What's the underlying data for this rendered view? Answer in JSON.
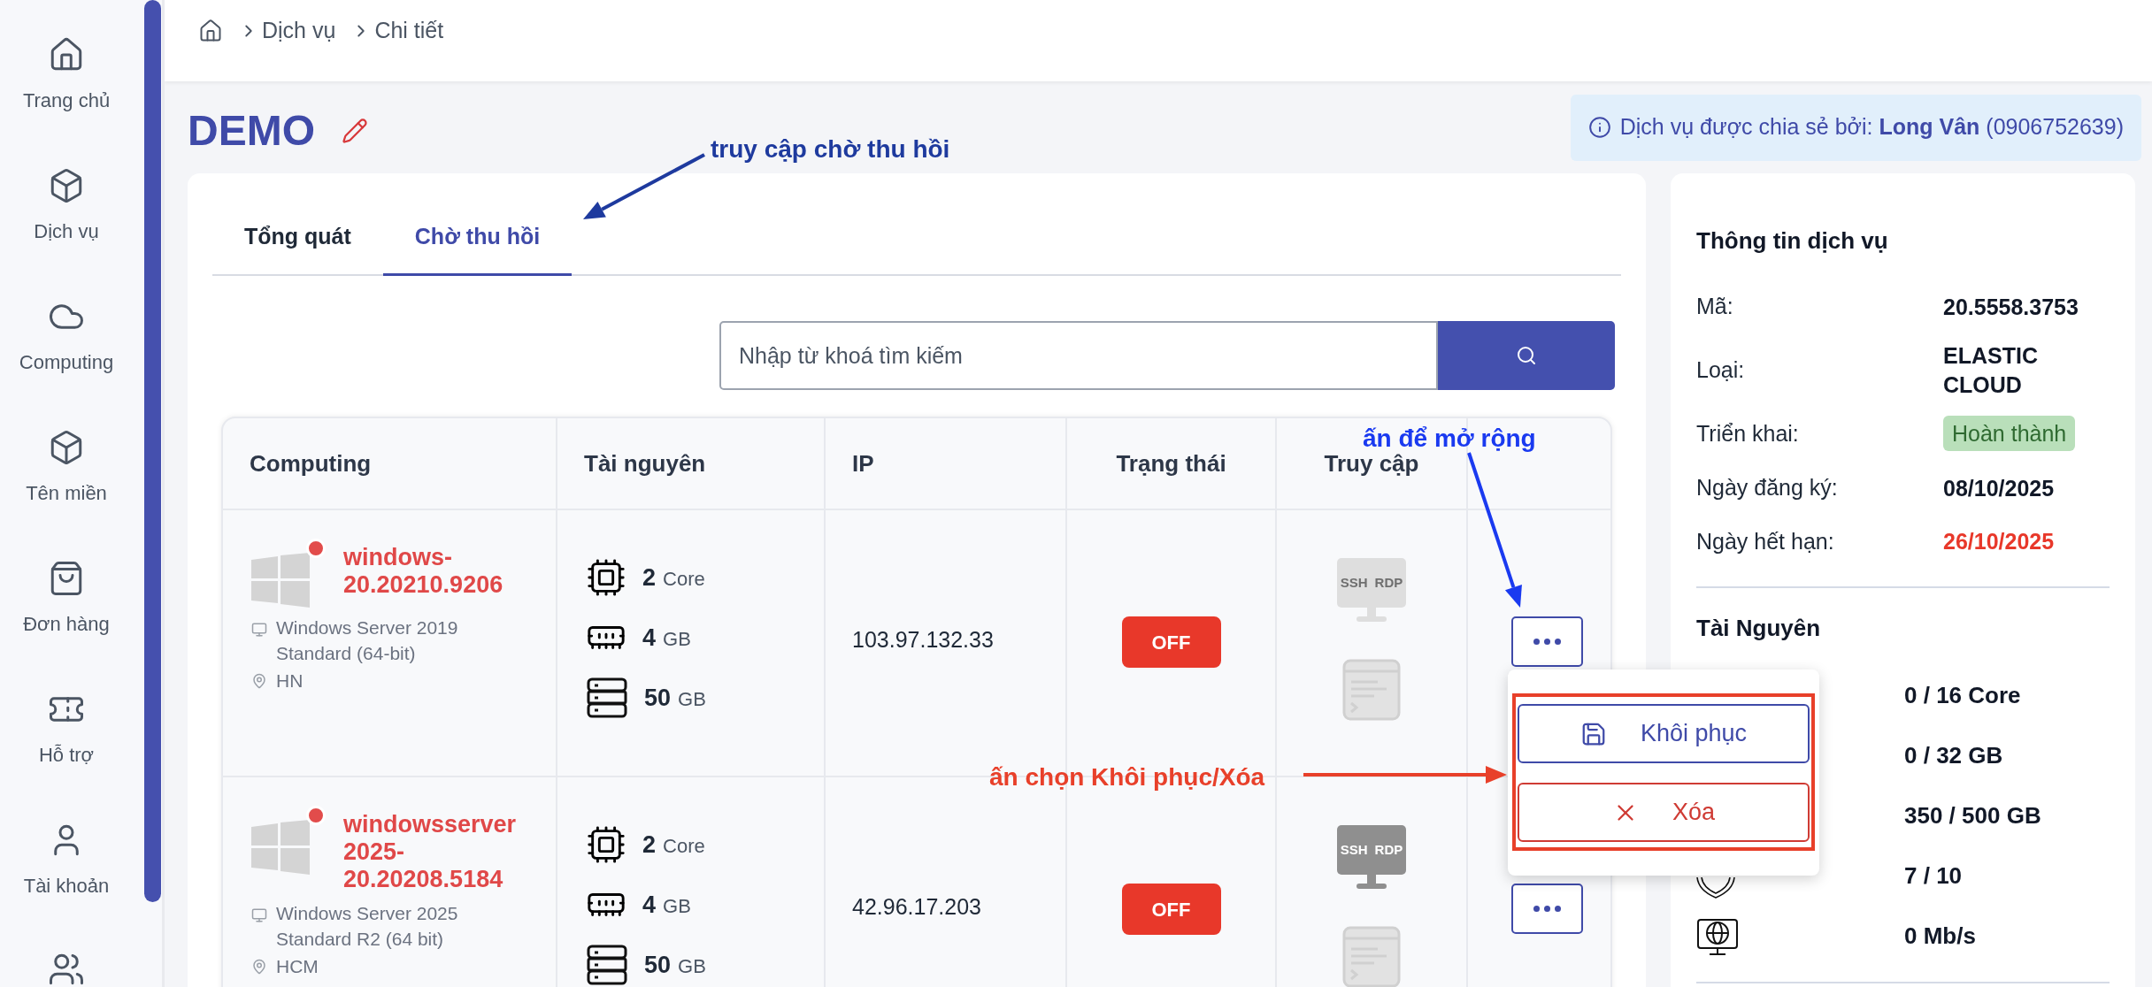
{
  "sidebar": {
    "items": [
      {
        "label": "Trang chủ"
      },
      {
        "label": "Dịch vụ"
      },
      {
        "label": "Computing"
      },
      {
        "label": "Tên miền"
      },
      {
        "label": "Đơn hàng"
      },
      {
        "label": "Hỗ trợ"
      },
      {
        "label": "Tài khoản"
      }
    ]
  },
  "breadcrumb": [
    "Dịch vụ",
    "Chi tiết"
  ],
  "title": "DEMO",
  "share_notice": "Dịch vụ được chia sẻ bởi: **Long Vân** (0906752639)",
  "tabs": [
    {
      "label": "Tổng quát",
      "selected": false
    },
    {
      "label": "Chờ thu hồi",
      "selected": true
    }
  ],
  "search": {
    "placeholder": "Nhập từ khoá tìm kiếm"
  },
  "table": {
    "columns": [
      "Computing",
      "Tài nguyên",
      "IP",
      "Trạng thái",
      "Truy cập"
    ],
    "rows": [
      {
        "name": "windows-20.20210.9206",
        "os": "Windows Server 2019 Standard (64-bit)",
        "location": "HN",
        "resources": [
          {
            "amount": "2",
            "unit": "Core"
          },
          {
            "amount": "4",
            "unit": "GB"
          },
          {
            "amount": "50",
            "unit": "GB"
          }
        ],
        "ip": "103.97.132.33",
        "status": "OFF",
        "access": {
          "ssh": "SSH",
          "rdp": "RDP",
          "dimmed": true
        },
        "menu_open": true
      },
      {
        "name": "windowsserver 2025-20.20208.5184",
        "os": "Windows Server 2025 Standard R2 (64 bit)",
        "location": "HCM",
        "resources": [
          {
            "amount": "2",
            "unit": "Core"
          },
          {
            "amount": "4",
            "unit": "GB"
          },
          {
            "amount": "50",
            "unit": "GB"
          }
        ],
        "ip": "42.96.17.203",
        "status": "OFF",
        "access": {
          "ssh": "SSH",
          "rdp": "RDP",
          "dimmed": false
        },
        "menu_open": false
      }
    ]
  },
  "row_menu": {
    "items": [
      {
        "kind": "restore",
        "label": "Khôi phục"
      },
      {
        "kind": "delete",
        "label": "Xóa"
      }
    ]
  },
  "service_info": {
    "title": "Thông tin dịch vụ",
    "fields": [
      {
        "label": "Mã:",
        "value": "20.5558.3753",
        "kind": "text"
      },
      {
        "label": "Loại:",
        "value": "ELASTIC CLOUD",
        "kind": "text"
      },
      {
        "label": "Triển khai:",
        "value": "Hoàn thành",
        "kind": "badge"
      },
      {
        "label": "Ngày đăng ký:",
        "value": "08/10/2025",
        "kind": "text"
      },
      {
        "label": "Ngày hết hạn:",
        "value": "26/10/2025",
        "kind": "danger"
      }
    ]
  },
  "resources": {
    "title": "Tài Nguyên",
    "items": [
      "0 / 16 Core",
      "0 / 32 GB",
      "350 / 500 GB",
      "7 / 10",
      "0 Mb/s"
    ]
  },
  "annotations": [
    {
      "text": "truy cập chờ thu hồi",
      "color": "#1e3a9e"
    },
    {
      "text": "ấn để mở rộng",
      "color": "#1a3af0"
    },
    {
      "text": "ấn chọn Khôi phục/Xóa",
      "color": "#e8402a"
    }
  ]
}
